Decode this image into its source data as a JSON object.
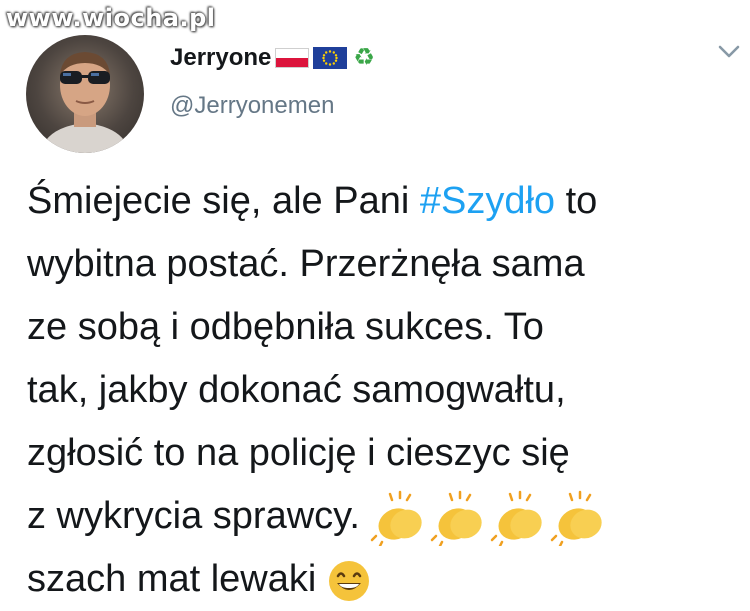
{
  "watermark": {
    "text": "www.wiocha.pl"
  },
  "author": {
    "display_name": "Jerryone",
    "handle": "@Jerryonemen",
    "badges": [
      "poland-flag-icon",
      "eu-flag-icon",
      "recycle-icon"
    ],
    "recycle_glyph": "♻"
  },
  "tweet": {
    "line1_before": "Śmiejecie się, ale Pani ",
    "hashtag": "#Szydło",
    "line1_after": " to",
    "line2": "wybitna postać. Przerżnęła sama",
    "line3": "ze sobą i odbębniła sukces. To",
    "line4": "tak, jakby dokonać samogwałtu,",
    "line5": "zgłosić to na policję i cieszyc się",
    "line6": "z wykrycia sprawcy.",
    "line6_emojis": [
      "clapping-hands-icon",
      "clapping-hands-icon",
      "clapping-hands-icon",
      "clapping-hands-icon"
    ],
    "line7": "szach mat lewaki",
    "line7_emoji": "grinning-face-icon"
  },
  "colors": {
    "hashtag": "#1da1f2",
    "handle": "#657786",
    "text": "#14171a",
    "emoji_yellow": "#f5c33b"
  }
}
